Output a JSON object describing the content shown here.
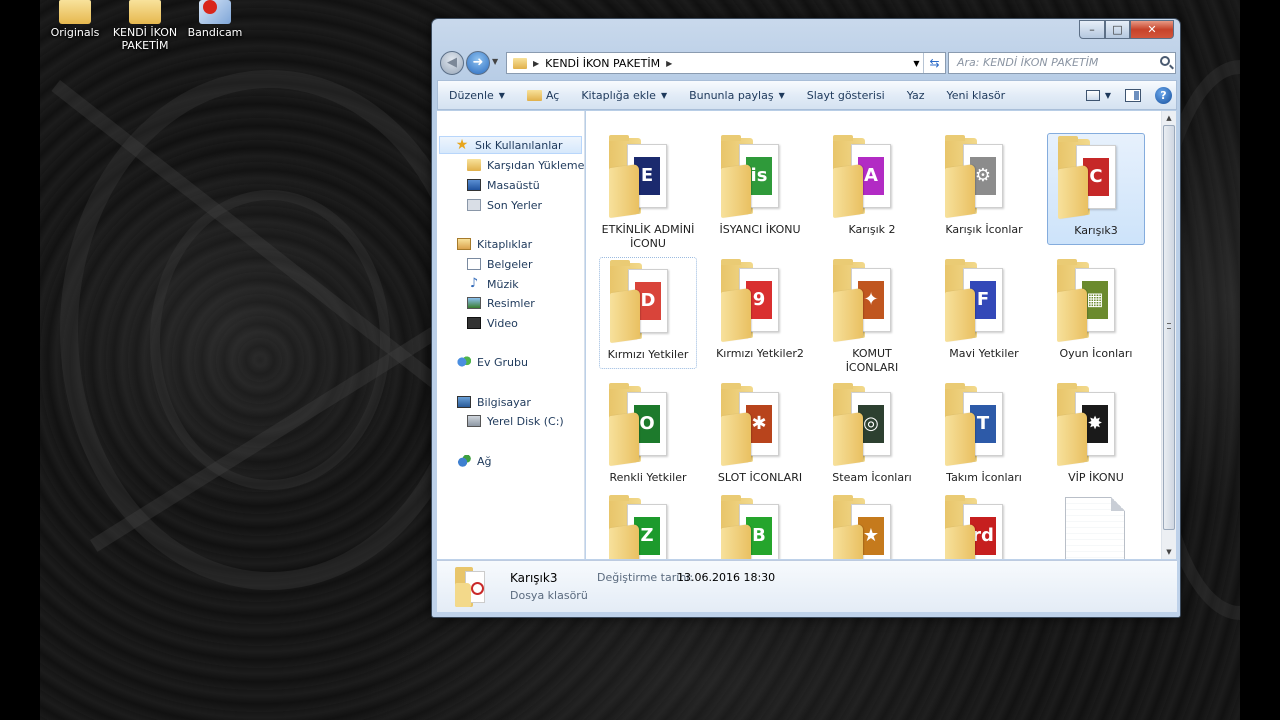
{
  "desktop": {
    "icons": [
      {
        "label": "Originals",
        "icon": "folder-icon"
      },
      {
        "label": "KENDİ İKON PAKETİM",
        "icon": "folder-icon"
      },
      {
        "label": "Bandicam",
        "icon": "bandicam-icon"
      }
    ]
  },
  "window": {
    "caption": {
      "minimize": "–",
      "maximize": "□",
      "close": "✕"
    },
    "address": {
      "path": "KENDİ İKON PAKETİM"
    },
    "search": {
      "placeholder": "Ara: KENDİ İKON PAKETİM"
    },
    "toolbar": {
      "organize": "Düzenle",
      "open": "Aç",
      "add_library": "Kitaplığa ekle",
      "share": "Bununla paylaş",
      "slideshow": "Slayt gösterisi",
      "print": "Yaz",
      "new_folder": "Yeni klasör",
      "help": "?"
    },
    "nav": {
      "favorites": "Sık Kullanılanlar",
      "downloads": "Karşıdan Yüklemeler",
      "desktop": "Masaüstü",
      "recent": "Son Yerler",
      "libraries": "Kitaplıklar",
      "documents": "Belgeler",
      "music": "Müzik",
      "pictures": "Resimler",
      "videos": "Video",
      "homegroup": "Ev Grubu",
      "computer": "Bilgisayar",
      "local_disk": "Yerel Disk (C:)",
      "network": "Ağ"
    },
    "items": [
      {
        "label": "ETKİNLİK ADMİNİ İCONU",
        "glyph": "E",
        "color": "#1b2a6e",
        "selected": false
      },
      {
        "label": "İSYANCI İKONU",
        "glyph": "is",
        "color": "#2f9a3a",
        "selected": false
      },
      {
        "label": "Karışık 2",
        "glyph": "A",
        "color": "#b22bc4",
        "selected": false
      },
      {
        "label": "Karışık İconlar",
        "glyph": "⚙",
        "color": "#8c8c8c",
        "selected": false
      },
      {
        "label": "Karışık3",
        "glyph": "C",
        "color": "#c62828",
        "selected": true
      },
      {
        "label": "Kırmızı Yetkiler",
        "glyph": "D",
        "color": "#d9443a",
        "selected": false
      },
      {
        "label": "Kırmızı Yetkiler2",
        "glyph": "9",
        "color": "#d92f2f",
        "selected": false
      },
      {
        "label": "KOMUT İCONLARI",
        "glyph": "✦",
        "color": "#c0561f",
        "selected": false
      },
      {
        "label": "Mavi Yetkiler",
        "glyph": "F",
        "color": "#3348b8",
        "selected": false
      },
      {
        "label": "Oyun İconları",
        "glyph": "▦",
        "color": "#6b8a2e",
        "selected": false
      },
      {
        "label": "Renkli Yetkiler",
        "glyph": "O",
        "color": "#1d7a2c",
        "selected": false
      },
      {
        "label": "SLOT İCONLARI",
        "glyph": "✱",
        "color": "#b8441c",
        "selected": false
      },
      {
        "label": "Steam İconları",
        "glyph": "◎",
        "color": "#2d4030",
        "selected": false
      },
      {
        "label": "Takım İconları",
        "glyph": "T",
        "color": "#2d5aa8",
        "selected": false
      },
      {
        "label": "VİP İKONU",
        "glyph": "✸",
        "color": "#1a1a1a",
        "selected": false
      },
      {
        "label": "",
        "glyph": "Z",
        "color": "#1d9a2c",
        "selected": false
      },
      {
        "label": "",
        "glyph": "B",
        "color": "#25a52c",
        "selected": false
      },
      {
        "label": "",
        "glyph": "★",
        "color": "#c57a1c",
        "selected": false
      },
      {
        "label": "",
        "glyph": "rd",
        "color": "#c61f1f",
        "selected": false
      },
      {
        "label": "",
        "glyph": "",
        "color": "",
        "selected": false,
        "file": true
      }
    ],
    "details": {
      "name": "Karışık3",
      "type": "Dosya klasörü",
      "modified_label": "Değiştirme tarihi:",
      "modified_value": "13.06.2016 18:30"
    }
  }
}
